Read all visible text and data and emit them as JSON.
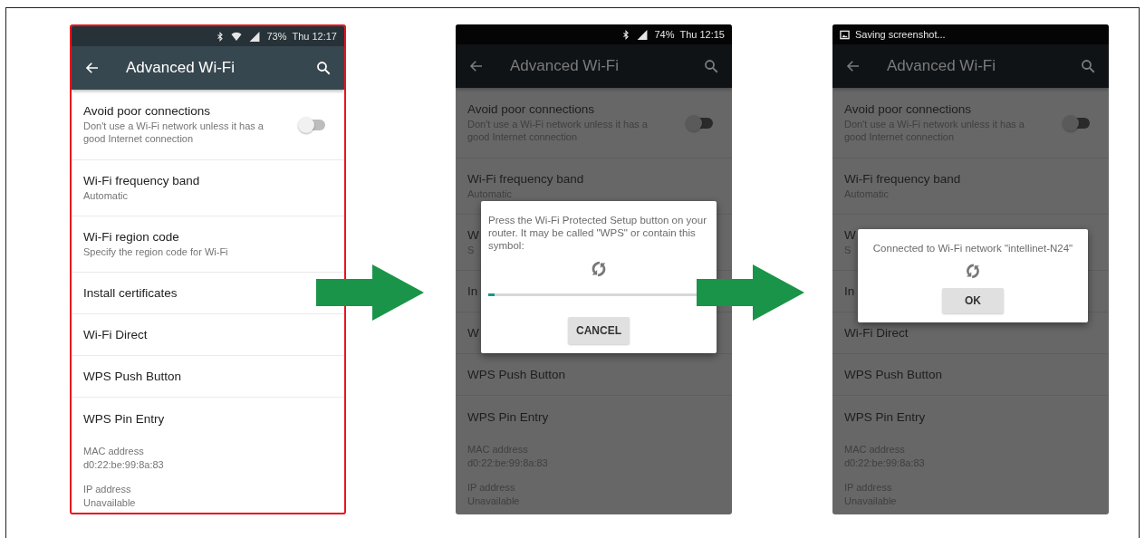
{
  "phones": [
    {
      "highlighted": true,
      "dimmed": false,
      "status_bar": {
        "indicators": [
          {
            "kind": "bluetooth"
          },
          {
            "kind": "wifi"
          },
          {
            "kind": "signal"
          }
        ],
        "battery": "73%",
        "time": "Thu 12:17"
      },
      "toolbar": {
        "title": "Advanced Wi-Fi"
      },
      "items": [
        {
          "kind": "switch",
          "title": "Avoid poor connections",
          "subtitle": "Don't use a Wi-Fi network unless it has a good Internet connection",
          "on": false
        },
        {
          "kind": "two-line",
          "title": "Wi-Fi frequency band",
          "subtitle": "Automatic"
        },
        {
          "kind": "two-line",
          "title": "Wi-Fi region code",
          "subtitle": "Specify the region code for Wi-Fi"
        },
        {
          "kind": "single",
          "title": "Install certificates"
        },
        {
          "kind": "single",
          "title": "Wi-Fi Direct"
        },
        {
          "kind": "single",
          "title": "WPS Push Button"
        },
        {
          "kind": "single",
          "title": "WPS Pin Entry"
        },
        {
          "kind": "info",
          "title": "MAC address",
          "subtitle": "d0:22:be:99:8a:83"
        },
        {
          "kind": "info",
          "title": "IP address",
          "subtitle": "Unavailable"
        }
      ]
    },
    {
      "highlighted": false,
      "dimmed": true,
      "status_bar": {
        "indicators": [
          {
            "kind": "bluetooth"
          },
          {
            "kind": "signal"
          }
        ],
        "battery": "74%",
        "time": "Thu 12:15"
      },
      "toolbar": {
        "title": "Advanced Wi-Fi"
      },
      "items": [
        {
          "kind": "switch",
          "title": "Avoid poor connections",
          "subtitle": "Don't use a Wi-Fi network unless it has a good Internet connection",
          "on": false
        },
        {
          "kind": "two-line",
          "title": "Wi-Fi frequency band",
          "subtitle": "Automatic"
        },
        {
          "kind": "two-line",
          "title": "W",
          "subtitle": "S"
        },
        {
          "kind": "single",
          "title": "In"
        },
        {
          "kind": "single",
          "title": "W"
        },
        {
          "kind": "single",
          "title": "WPS Push Button"
        },
        {
          "kind": "single",
          "title": "WPS Pin Entry"
        },
        {
          "kind": "info",
          "title": "MAC address",
          "subtitle": "d0:22:be:99:8a:83"
        },
        {
          "kind": "info",
          "title": "IP address",
          "subtitle": "Unavailable"
        }
      ],
      "dialog": {
        "message": "Press the Wi-Fi Protected Setup button on your router. It may be called \"WPS\" or contain this symbol:",
        "progress": {
          "level": 0.03
        },
        "button": "CANCEL"
      }
    },
    {
      "highlighted": false,
      "dimmed": true,
      "status_bar": {
        "notification": "Saving screenshot..."
      },
      "toolbar": {
        "title": "Advanced Wi-Fi"
      },
      "items": [
        {
          "kind": "switch",
          "title": "Avoid poor connections",
          "subtitle": "Don't use a Wi-Fi network unless it has a good Internet connection",
          "on": false
        },
        {
          "kind": "two-line",
          "title": "Wi-Fi frequency band",
          "subtitle": "Automatic"
        },
        {
          "kind": "two-line",
          "title": "W",
          "subtitle": "S"
        },
        {
          "kind": "single",
          "title": "In"
        },
        {
          "kind": "single",
          "title": "Wi-Fi Direct"
        },
        {
          "kind": "single",
          "title": "WPS Push Button"
        },
        {
          "kind": "single",
          "title": "WPS Pin Entry"
        },
        {
          "kind": "info",
          "title": "MAC address",
          "subtitle": "d0:22:be:99:8a:83"
        },
        {
          "kind": "info",
          "title": "IP address",
          "subtitle": "Unavailable"
        }
      ],
      "dialog": {
        "message": "Connected to Wi-Fi network \"intellinet-N24\"",
        "button": "OK"
      }
    }
  ]
}
